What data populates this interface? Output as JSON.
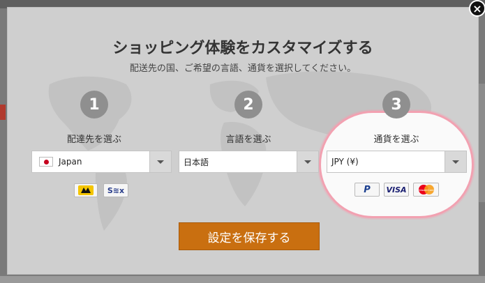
{
  "dialog": {
    "title": "ショッピング体験をカスタマイズする",
    "subtitle": "配送先の国、ご希望の言語、通貨を選択してください。",
    "close_label": "×",
    "save_label": "設定を保存する"
  },
  "steps": [
    {
      "number": "1",
      "label": "配達先を選ぶ",
      "selected": "Japan",
      "icon": "japan-flag-icon"
    },
    {
      "number": "2",
      "label": "言語を選ぶ",
      "selected": "日本語"
    },
    {
      "number": "3",
      "label": "通貨を選ぶ",
      "selected": "JPY (¥)"
    }
  ],
  "shipping_badges": [
    {
      "icon": "yamato-transport-logo",
      "label": ""
    },
    {
      "icon": "sagawa-express-logo",
      "label": "S≋x"
    }
  ],
  "payment_badges": [
    {
      "icon": "paypal-logo",
      "label": "P"
    },
    {
      "icon": "visa-logo",
      "label": "VISA"
    },
    {
      "icon": "mastercard-logo",
      "label": "MasterCard"
    }
  ],
  "colors": {
    "accent_button": "#c96f10",
    "highlight_ring": "#f2a1b1",
    "step_circle": "#8f8f8f"
  }
}
